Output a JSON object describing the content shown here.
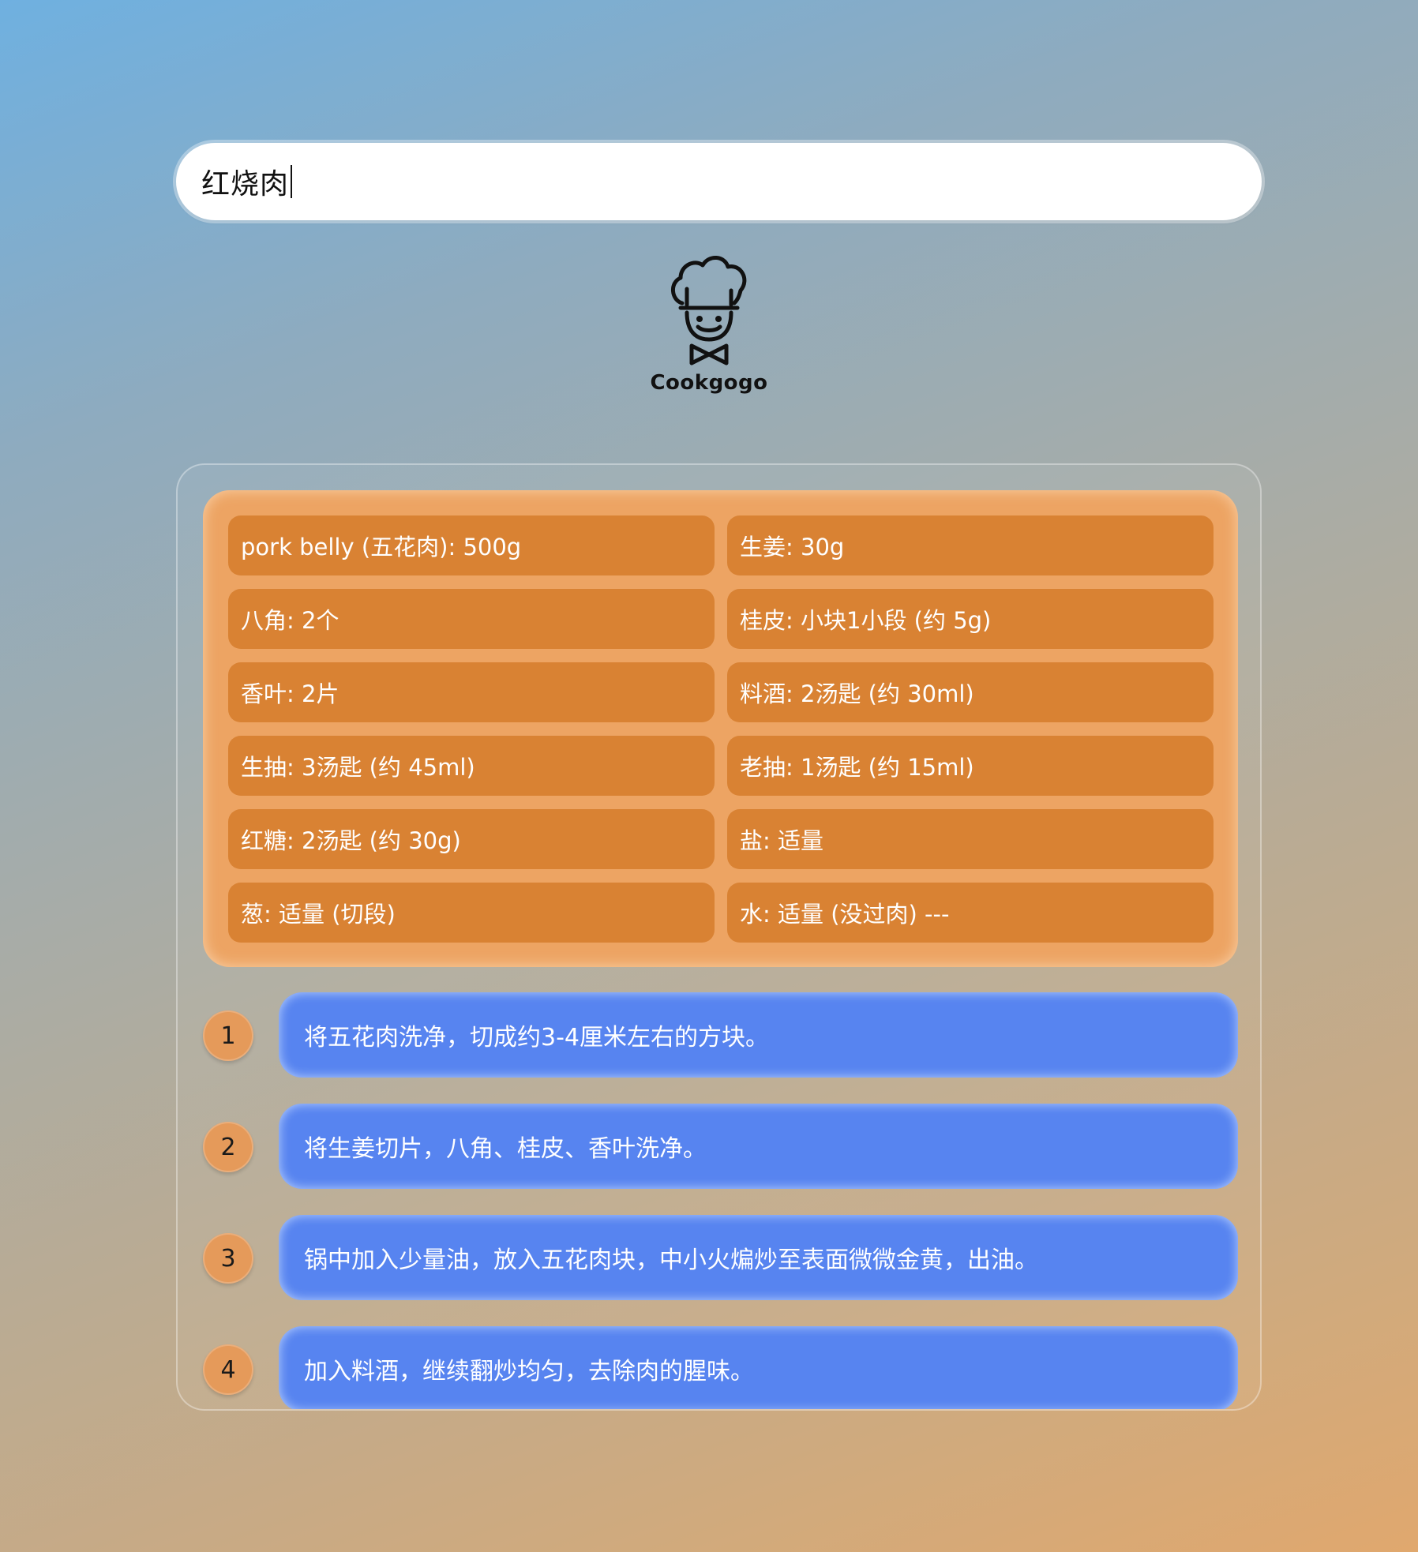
{
  "search": {
    "value": "红烧肉"
  },
  "logo": {
    "text": "Cookgogo"
  },
  "ingredients": [
    "pork belly (五花肉): 500g",
    "生姜: 30g",
    "八角: 2个",
    "桂皮: 小块1小段 (约 5g)",
    "香叶: 2片",
    "料酒: 2汤匙 (约 30ml)",
    "生抽: 3汤匙 (约 45ml)",
    "老抽: 1汤匙 (约 15ml)",
    "红糖: 2汤匙 (约 30g)",
    "盐: 适量",
    "葱: 适量 (切段)",
    "水: 适量 (没过肉) ---"
  ],
  "steps": [
    {
      "number": "1",
      "text": "将五花肉洗净，切成约3-4厘米左右的方块。"
    },
    {
      "number": "2",
      "text": "将生姜切片，八角、桂皮、香叶洗净。"
    },
    {
      "number": "3",
      "text": "锅中加入少量油，放入五花肉块，中小火煸炒至表面微微金黄，出油。"
    },
    {
      "number": "4",
      "text": "加入料酒，继续翻炒均匀，去除肉的腥味。"
    }
  ],
  "colors": {
    "ingredient_panel": "#eda463",
    "ingredient_tile": "#d98233",
    "step_bubble": "#5784f0",
    "step_number": "#e59a5a"
  }
}
